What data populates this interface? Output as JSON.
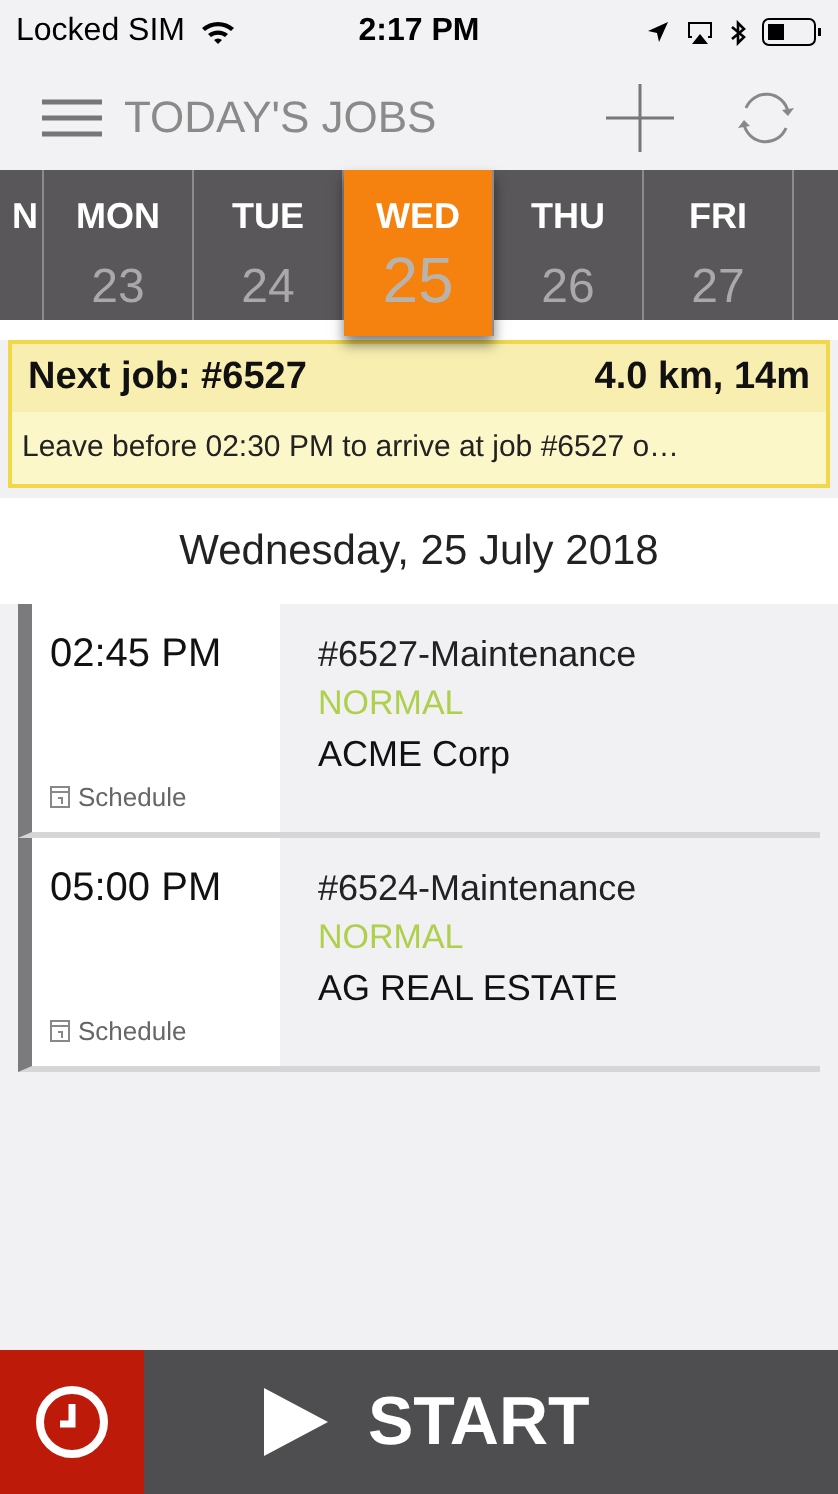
{
  "status_bar": {
    "carrier": "Locked SIM",
    "time": "2:17 PM"
  },
  "header": {
    "title": "TODAY'S JOBS"
  },
  "days": [
    {
      "name": "N",
      "selected": false
    },
    {
      "name": "MON",
      "date": "23",
      "selected": false
    },
    {
      "name": "TUE",
      "date": "24",
      "selected": false
    },
    {
      "name": "WED",
      "date": "25",
      "selected": true
    },
    {
      "name": "THU",
      "date": "26",
      "selected": false
    },
    {
      "name": "FRI",
      "date": "27",
      "selected": false
    }
  ],
  "next_job": {
    "title": "Next job: #6527",
    "distance": "4.0 km, 14m",
    "message": "Leave before 02:30 PM to arrive at job #6527 o…"
  },
  "date_heading": "Wednesday, 25 July 2018",
  "jobs": [
    {
      "time": "02:45 PM",
      "type": "Schedule",
      "title": "#6527-Maintenance",
      "priority": "NORMAL",
      "client": "ACME Corp"
    },
    {
      "time": "05:00 PM",
      "type": "Schedule",
      "title": "#6524-Maintenance",
      "priority": "NORMAL",
      "client": "AG REAL ESTATE"
    }
  ],
  "start_button": "START"
}
